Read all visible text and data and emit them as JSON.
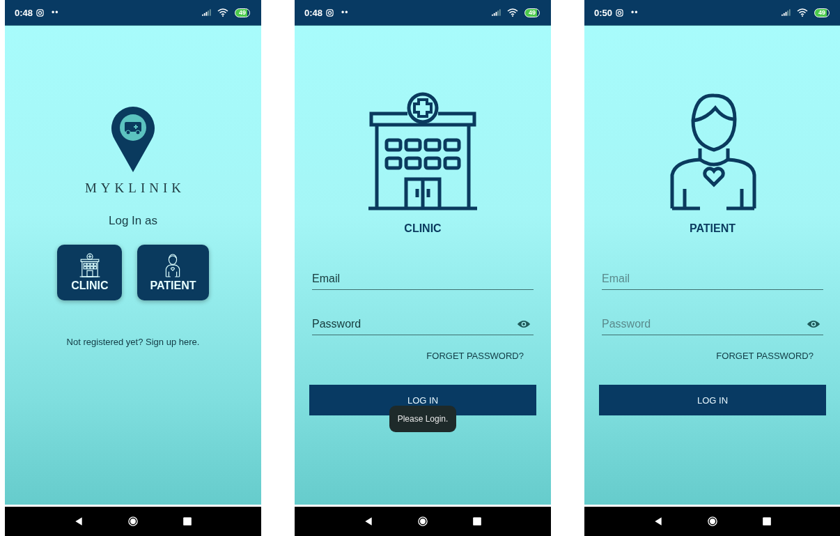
{
  "screens": [
    {
      "kind": "role_select",
      "status_bar": {
        "time": "0:48",
        "dots": "••",
        "battery": "49"
      },
      "app_name": "MYKLINIK",
      "prompt": "Log In as",
      "role_buttons": [
        {
          "label": "CLINIC",
          "kind": "clinic"
        },
        {
          "label": "PATIENT",
          "kind": "patient"
        }
      ],
      "signup_text": "Not registered yet? Sign up here."
    },
    {
      "kind": "login",
      "status_bar": {
        "time": "0:48",
        "dots": "••",
        "battery": "49"
      },
      "role": {
        "label": "CLINIC",
        "kind": "clinic"
      },
      "email": {
        "placeholder": "Email",
        "dimmed": false
      },
      "password": {
        "placeholder": "Password",
        "dimmed": false
      },
      "forgot": "FORGET PASSWORD?",
      "login_button": "LOG IN",
      "toast": "Please Login."
    },
    {
      "kind": "login",
      "status_bar": {
        "time": "0:50",
        "dots": "••",
        "battery": "49"
      },
      "role": {
        "label": "PATIENT",
        "kind": "patient"
      },
      "email": {
        "placeholder": "Email",
        "dimmed": true
      },
      "password": {
        "placeholder": "Password",
        "dimmed": true
      },
      "forgot": "FORGET PASSWORD?",
      "login_button": "LOG IN"
    }
  ]
}
